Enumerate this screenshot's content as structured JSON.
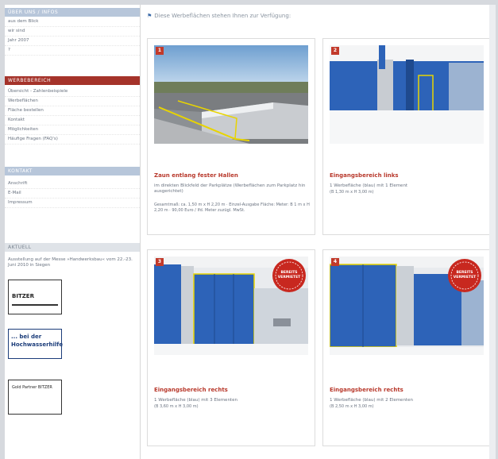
{
  "sidebar": {
    "sections": [
      {
        "label": "ÜBER UNS / INFOS",
        "items": [
          "aus dem Blick",
          "wir sind",
          "Jahr 2007",
          "?"
        ]
      },
      {
        "label": "WERBEBEREICH",
        "items": [
          "Übersicht - Zahlenbeispiele",
          "Werbeflächen",
          "Fläche bestellen",
          "Kontakt",
          "Möglichkeiten",
          "Häufige Fragen (FAQ's)"
        ]
      },
      {
        "label": "KONTAKT",
        "items": [
          "Anschrift",
          "E-Mail",
          "Impressum"
        ]
      },
      {
        "label": "AKTUELL",
        "items": []
      }
    ],
    "news": "Ausstellung auf der Messe »Handwerksbau« vom 22.-23. Juni 2010 in Siegen",
    "logos": [
      "BITZER",
      "... bei der Hochwasserhilfe",
      "Gold Partner BITZER"
    ]
  },
  "main": {
    "heading": "Diese Werbeflächen stehen Ihnen zur Verfügung:",
    "cards": [
      {
        "num": "1",
        "title": "Zaun entlang fester Hallen",
        "desc": "im direkten Blickfeld der Parkplätze (Werbeflächen zum Parkplatz hin ausgerichtet)",
        "spec": "Gesamtmaß: ca. 1,50 m x H 2,20 m · Einzel-Ausgabe Fläche: Meter: B 1 m x H 2,20 m · 90,00 Euro / lfd. Meter zuzügl. MwSt.",
        "badge": ""
      },
      {
        "num": "2",
        "title": "Eingangsbereich links",
        "desc": "1 Werbefläche (blau) mit 1 Element",
        "spec": "(B 1,30 m x H 3,00 m)",
        "badge": ""
      },
      {
        "num": "3",
        "title": "Eingangsbereich rechts",
        "desc": "1 Werbefläche (blau) mit 3 Elementen",
        "spec": "(B 3,60 m x H 3,00 m)",
        "badge": "BEREITS VERMIETET"
      },
      {
        "num": "4",
        "title": "Eingangsbereich rechts",
        "desc": "1 Werbefläche (blau) mit 2 Elementen",
        "spec": "(B 2,50 m x H 3,00 m)",
        "badge": "BEREITS VERMIETET"
      }
    ]
  },
  "colors": {
    "accent_red": "#b8392c",
    "section_blue": "#b7c6da",
    "panel_blue": "#2d63b8"
  }
}
